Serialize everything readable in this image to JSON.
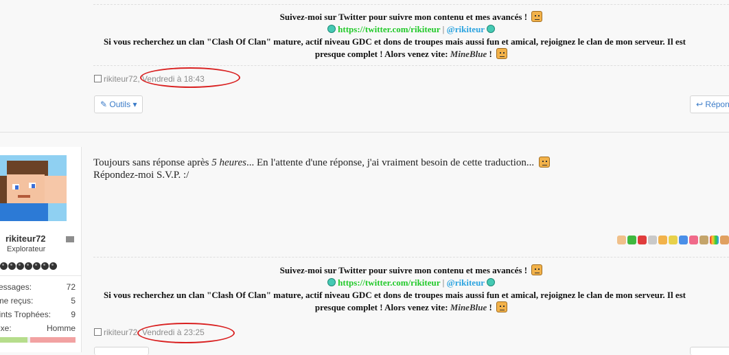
{
  "post1": {
    "signature": {
      "line1_text": "Suivez-moi sur Twitter pour suivre mon contenu et mes avancés !",
      "twitter_url": "https://twitter.com/rikiteur",
      "separator": "|",
      "twitter_handle": "@rikiteur",
      "line3": "Si vous recherchez un clan \"Clash Of Clan\" mature, actif niveau GDC et dons de troupes mais aussi fun et amical, rejoignez le clan de mon serveur. Il est",
      "line4_text": "presque complet ! Alors venez vite:",
      "server_name": "MineBlue",
      "line4_end": "!"
    },
    "author": "rikiteur72",
    "separator": ",",
    "date": "Vendredi à 18:43",
    "tools_button": "Outils",
    "reply_button": "Répondre"
  },
  "post2": {
    "user": {
      "name": "rikiteur72",
      "title": "Explorateur",
      "stats": [
        {
          "label": "Messages:",
          "value": "72"
        },
        {
          "label": "J'aime reçus:",
          "value": "5"
        },
        {
          "label": "Points Trophées:",
          "value": "9"
        },
        {
          "label": "Sexe:",
          "value": "Homme"
        }
      ],
      "rank_icons": 7
    },
    "message_part1": "Toujours sans réponse après",
    "message_italic": "5 heures",
    "message_part2": "... En l'attente d'une réponse, j'ai vraiment besoin de cette traduction...",
    "message_line2": "Répondez-moi S.V.P. :/",
    "signature": {
      "line1_text": "Suivez-moi sur Twitter pour suivre mon contenu et mes avancés !",
      "twitter_url": "https://twitter.com/rikiteur",
      "separator": "|",
      "twitter_handle": "@rikiteur",
      "line3": "Si vous recherchez un clan \"Clash Of Clan\" mature, actif niveau GDC et dons de troupes mais aussi fun et amical, rejoignez le clan de mon serveur. Il est",
      "line4_text": "presque complet ! Alors venez vite:",
      "server_name": "MineBlue",
      "line4_end": "!"
    },
    "author": "rikiteur72",
    "separator": ",",
    "date": "Vendredi à 23:25"
  },
  "reaction_icons": [
    "thumbs-up",
    "check",
    "cross",
    "chat",
    "smile",
    "star",
    "info",
    "heart",
    "wrench",
    "rainbow",
    "brush"
  ],
  "colors": {
    "link_green": "#22c92a",
    "link_blue": "#2ba3df",
    "annotation_red": "#d92020",
    "button_blue": "#3a7bc8"
  }
}
